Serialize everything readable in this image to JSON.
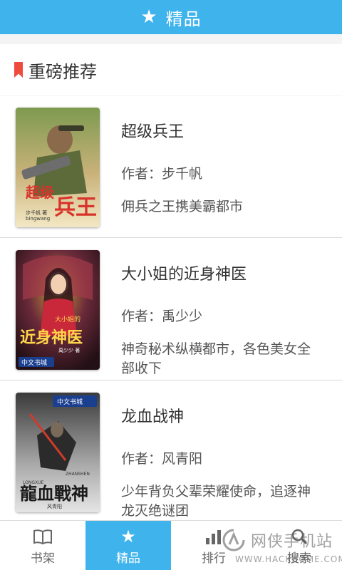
{
  "header": {
    "title": "精品",
    "icon": "star-icon"
  },
  "section": {
    "title": "重磅推荐",
    "icon": "bookmark-icon",
    "accent": "#ef4b3f"
  },
  "books": [
    {
      "title": "超级兵王",
      "author": "作者：步千帆",
      "description": "佣兵之王携美霸都市",
      "cover_title": "超级兵王",
      "cover_sub": "bingwang",
      "cover_author": "步千帆 著"
    },
    {
      "title": "大小姐的近身神医",
      "author": "作者：禹少少",
      "description": "神奇秘术纵横都市，各色美女全部收下",
      "cover_title": "近身神医",
      "cover_top": "大小姐的",
      "cover_author": "禹少少 著",
      "cover_brand": "中文书城"
    },
    {
      "title": "龙血战神",
      "author": "作者：风青阳",
      "description": "少年背负父辈荣耀使命，追逐神龙灭绝谜团",
      "cover_title": "龍血戰神",
      "cover_sub": "ZHANSHEN",
      "cover_sub2": "LONGXUE",
      "cover_brand": "中文书城",
      "cover_author": "风青阳"
    }
  ],
  "tabs": [
    {
      "label": "书架",
      "icon": "book-icon",
      "active": false
    },
    {
      "label": "精品",
      "icon": "star-icon",
      "active": true
    },
    {
      "label": "排行",
      "icon": "bar-chart-icon",
      "active": false
    },
    {
      "label": "搜索",
      "icon": "search-icon",
      "active": false
    }
  ],
  "watermark": {
    "text_cn": "网侠手机站",
    "text_en": "WWW.HACKHOME.COM"
  },
  "colors": {
    "primary": "#3eb3ec",
    "accent": "#ef4b3f"
  }
}
